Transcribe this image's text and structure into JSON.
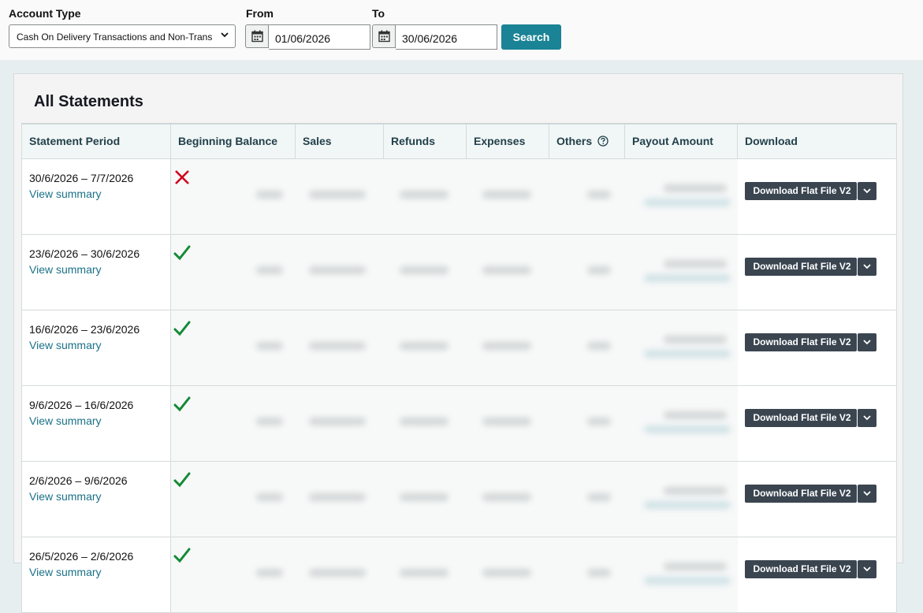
{
  "filters": {
    "account_type_label": "Account Type",
    "account_type_value": "Cash On Delivery Transactions and Non-Transactional",
    "from_label": "From",
    "from_value": "01/06/2026",
    "to_label": "To",
    "to_value": "30/06/2026",
    "search_label": "Search"
  },
  "panel": {
    "title": "All Statements"
  },
  "table": {
    "headers": [
      "Statement Period",
      "Beginning Balance",
      "Sales",
      "Refunds",
      "Expenses",
      "Others",
      "Payout Amount",
      "Download"
    ],
    "rows": [
      {
        "period": "30/6/2026 – 7/7/2026",
        "link": "View summary",
        "status": "error",
        "download": "Download Flat File V2"
      },
      {
        "period": "23/6/2026 – 30/6/2026",
        "link": "View summary",
        "status": "ok",
        "download": "Download Flat File V2"
      },
      {
        "period": "16/6/2026 – 23/6/2026",
        "link": "View summary",
        "status": "ok",
        "download": "Download Flat File V2"
      },
      {
        "period": "9/6/2026 – 16/6/2026",
        "link": "View summary",
        "status": "ok",
        "download": "Download Flat File V2"
      },
      {
        "period": "2/6/2026 – 9/6/2026",
        "link": "View summary",
        "status": "ok",
        "download": "Download Flat File V2"
      },
      {
        "period": "26/5/2026 – 2/6/2026",
        "link": "View summary",
        "status": "ok",
        "download": "Download Flat File V2"
      }
    ]
  },
  "icons": {
    "calendar": "calendar-icon",
    "chevron": "chevron-down-icon",
    "help": "help-circle-icon",
    "check": "check-icon",
    "error": "x-icon"
  },
  "colors": {
    "accent": "#1a8395",
    "link": "#1a7187",
    "ok": "#138a36",
    "error": "#d0021b",
    "button_dark": "#3a4550"
  }
}
